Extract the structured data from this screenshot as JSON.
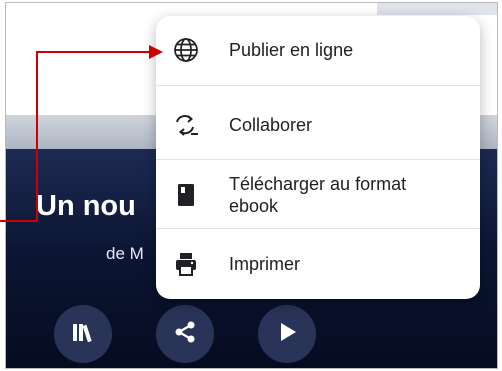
{
  "book": {
    "title_visible": "Un nou",
    "author_visible": "de M"
  },
  "menu": {
    "items": [
      {
        "label": "Publier en ligne",
        "icon": "globe-icon"
      },
      {
        "label": "Collaborer",
        "icon": "collaborate-icon"
      },
      {
        "label": "Télécharger au format ebook",
        "line1": "Télécharger au format",
        "line2": "ebook",
        "icon": "ebook-icon"
      },
      {
        "label": "Imprimer",
        "icon": "printer-icon"
      }
    ]
  },
  "actions": [
    {
      "icon": "library-icon"
    },
    {
      "icon": "share-icon"
    },
    {
      "icon": "play-icon"
    }
  ],
  "colors": {
    "callout": "#cc0000",
    "cover_dark": "#0c1634",
    "button_bg": "#2a3458",
    "menu_text": "#202124"
  }
}
